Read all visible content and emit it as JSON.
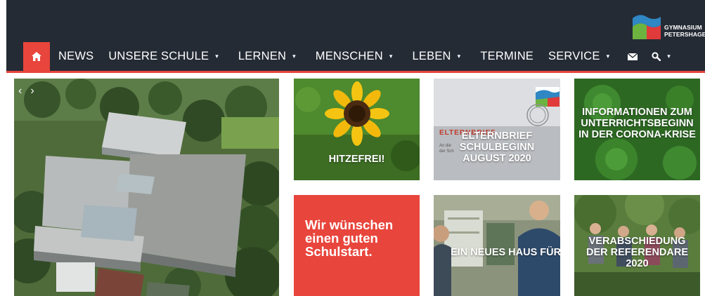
{
  "brand": {
    "line1": "GYMNASIUM",
    "line2": "PETERSHAGEN",
    "colors": {
      "header_bg": "#252b35",
      "accent": "#e8453c",
      "logo_green": "#6cb43f",
      "logo_blue": "#2f87c4",
      "logo_red": "#e03a3a"
    }
  },
  "nav": {
    "home_icon": "home-icon",
    "items": [
      {
        "label": "NEWS",
        "has_dropdown": false
      },
      {
        "label": "UNSERE SCHULE",
        "has_dropdown": true
      },
      {
        "label": "LERNEN",
        "has_dropdown": true
      },
      {
        "label": "MENSCHEN",
        "has_dropdown": true
      },
      {
        "label": "LEBEN",
        "has_dropdown": true
      },
      {
        "label": "TERMINE",
        "has_dropdown": false
      },
      {
        "label": "SERVICE",
        "has_dropdown": true
      }
    ],
    "caret": "▾",
    "mail_icon": "mail-icon",
    "search_icon": "search-icon"
  },
  "hero": {
    "prev": "‹",
    "next": "›"
  },
  "tiles": [
    {
      "title": "HITZEFREI!"
    },
    {
      "title": "ELTERNBRIEF SCHULBEGINN AUGUST 2020",
      "doc_text": "ELTERNBRIEF",
      "doc_small1": "An die",
      "doc_small2": "der Sch"
    },
    {
      "title": "INFORMATIONEN ZUM UNTERRICHTSBEGINN IN DER CORONA-KRISE"
    },
    {
      "title": "Wir wünschen einen guten Schulstart."
    },
    {
      "title": "EIN NEUES HAUS FÜR DIE NATURWISSENSCHAFTEN"
    },
    {
      "title": "VERABSCHIEDUNG DER REFERENDARE 2020"
    }
  ]
}
